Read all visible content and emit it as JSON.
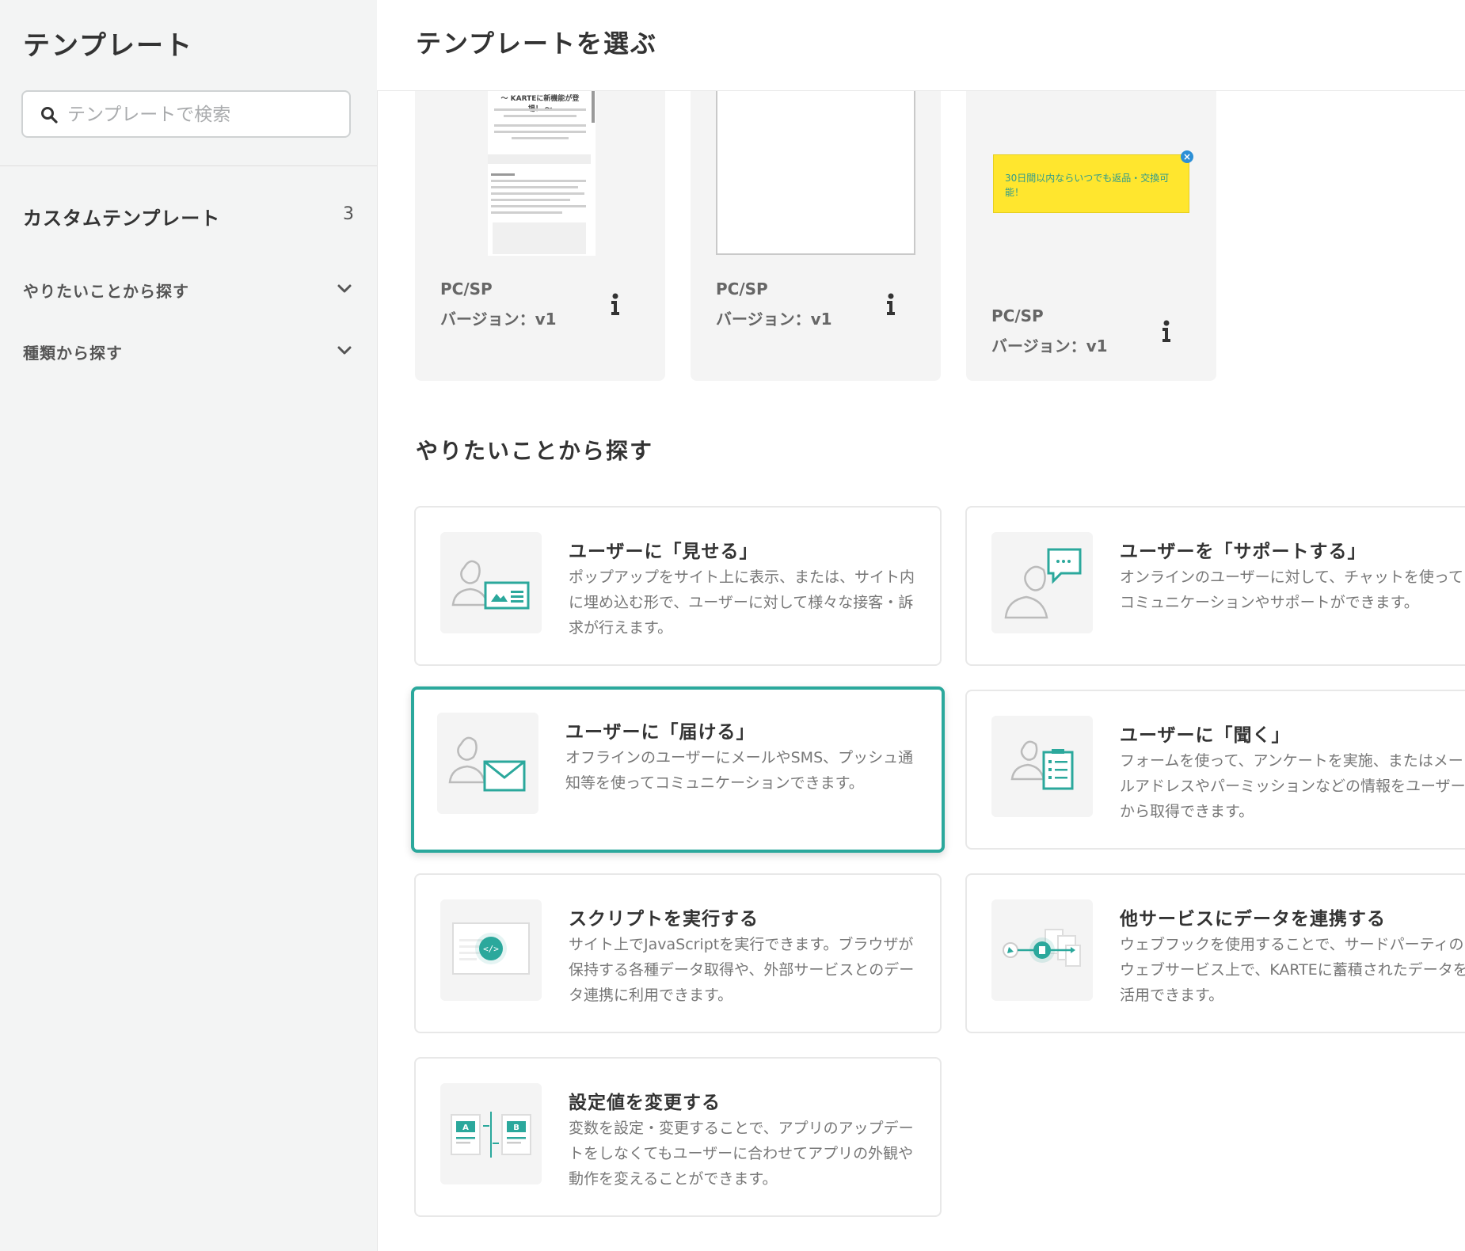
{
  "sidebar": {
    "title": "テンプレート",
    "search_placeholder": "テンプレートで検索",
    "custom": {
      "label": "カスタムテンプレート",
      "count": "3"
    },
    "accordions": [
      {
        "label": "やりたいことから探す"
      },
      {
        "label": "種類から探す"
      }
    ]
  },
  "main": {
    "title": "テンプレートを選ぶ",
    "templates": [
      {
        "device": "PC/SP",
        "version": "バージョン：v1",
        "preview_title": "〜 KARTEに新機能が登場！ 〜"
      },
      {
        "device": "PC/SP",
        "version": "バージョン：v1"
      },
      {
        "device": "PC/SP",
        "version": "バージョン：v1",
        "preview_text": "30日間以内ならいつでも返品・交換可能！"
      }
    ],
    "section_title": "やりたいことから探す",
    "cards": [
      {
        "title": "ユーザーに「見せる」",
        "desc": "ポップアップをサイト上に表示、または、サイト内に埋め込む形で、ユーザーに対して様々な接客・訴求が行えます。",
        "icon": "show-icon"
      },
      {
        "title": "ユーザーを「サポートする」",
        "desc": "オンラインのユーザーに対して、チャットを使ってコミュニケーションやサポートができます。",
        "icon": "support-chat-icon"
      },
      {
        "title": "ユーザーに「届ける」",
        "desc": "オフラインのユーザーにメールやSMS、プッシュ通知等を使ってコミュニケーションできます。",
        "icon": "mail-icon"
      },
      {
        "title": "ユーザーに「聞く」",
        "desc": "フォームを使って、アンケートを実施、またはメールアドレスやパーミッションなどの情報をユーザーから取得できます。",
        "icon": "survey-icon"
      },
      {
        "title": "スクリプトを実行する",
        "desc": "サイト上でJavaScriptを実行できます。ブラウザが保持する各種データ取得や、外部サービスとのデータ連携に利用できます。",
        "icon": "script-icon"
      },
      {
        "title": "他サービスにデータを連携する",
        "desc": "ウェブフックを使用することで、サードパーティのウェブサービス上で、KARTEに蓄積されたデータを活用できます。",
        "icon": "webhook-icon"
      },
      {
        "title": "設定値を変更する",
        "desc": "変数を設定・変更することで、アプリのアップデートをしなくてもユーザーに合わせてアプリの外観や動作を変えることができます。",
        "icon": "ab-variable-icon"
      }
    ]
  },
  "colors": {
    "accent": "#2ba89c",
    "sidebar_bg": "#f3f4f4",
    "yellow": "#ffe62e"
  }
}
